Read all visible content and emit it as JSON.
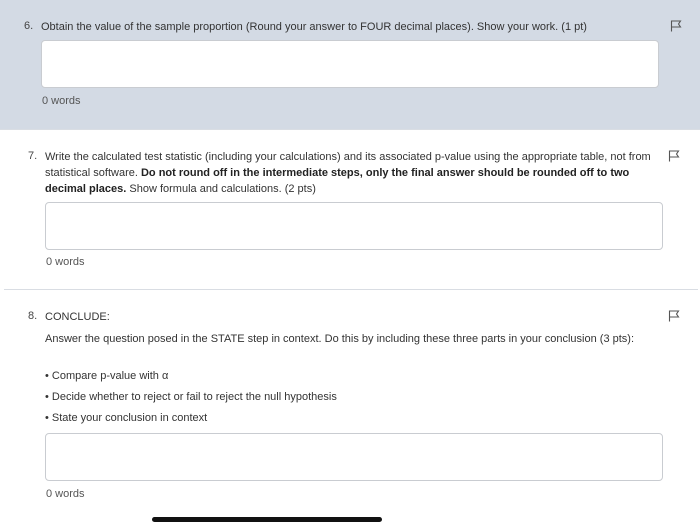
{
  "q6": {
    "number": "6.",
    "prompt": "Obtain the value of the sample proportion (Round your answer to FOUR decimal places). Show your work. (1 pt)",
    "word_count": "0 words"
  },
  "q7": {
    "number": "7.",
    "prompt_a": "Write the calculated test statistic (including your calculations) and its associated p-value using the appropriate table, not from statistical software.",
    "prompt_bold": "Do not round off in the intermediate steps, only the final answer should be rounded off to two decimal places.",
    "prompt_b": "Show formula and calculations. (2 pts)",
    "word_count": "0 words"
  },
  "q8": {
    "number": "8.",
    "heading": "CONCLUDE:",
    "prompt": "Answer the question posed in the STATE step in context. Do this by including these three parts in your conclusion (3 pts):",
    "bullets": [
      "• Compare p-value with α",
      "• Decide whether to reject or fail to reject the null hypothesis",
      "• State your conclusion in context"
    ],
    "word_count": "0 words"
  },
  "icons": {
    "flag": "flag-icon"
  },
  "colors": {
    "highlight_bg": "#d3dae4",
    "border": "#c9ccd1"
  }
}
